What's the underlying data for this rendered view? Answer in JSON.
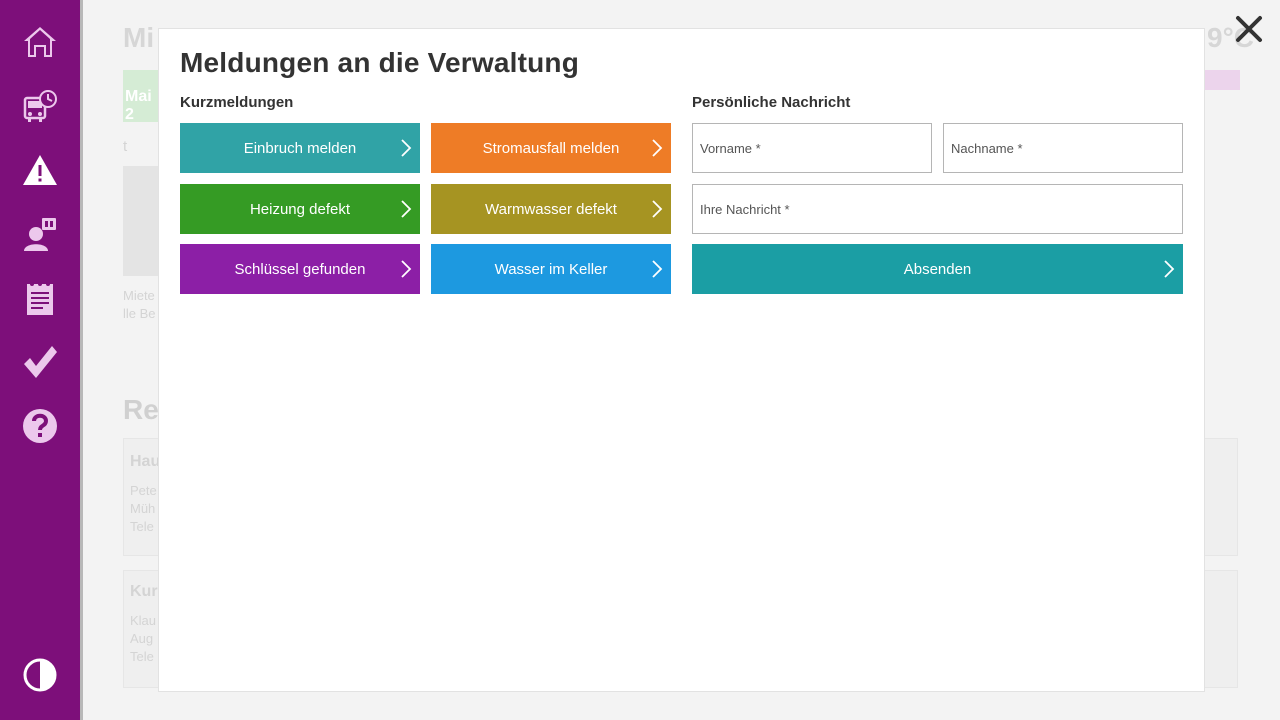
{
  "sidebar": {
    "items": [
      {
        "icon": "home-icon"
      },
      {
        "icon": "transport-schedule-icon"
      },
      {
        "icon": "warning-icon"
      },
      {
        "icon": "contact-person-icon"
      },
      {
        "icon": "notepad-icon"
      },
      {
        "icon": "checkmark-icon"
      },
      {
        "icon": "help-icon"
      }
    ],
    "bottom_icon": "contrast-icon"
  },
  "background": {
    "title": "Mi",
    "temperature": "9°C",
    "date": "Mai 2",
    "label_t": "t",
    "text1": "Miete",
    "text2": "lle Be",
    "heading2": "Re",
    "card1_title": "Hau",
    "card1_lines": [
      "Pete",
      "Müh",
      "Tele"
    ],
    "card2_title": "Kur",
    "card2_lines": [
      "Klau",
      "Aug",
      "Tele"
    ]
  },
  "modal": {
    "title": "Meldungen an die Verwaltung",
    "quick_label": "Kurzmeldungen",
    "personal_label": "Persönliche Nachricht",
    "quick_buttons": [
      {
        "label": "Einbruch melden",
        "color": "#30a3a6"
      },
      {
        "label": "Stromausfall melden",
        "color": "#ee7c26"
      },
      {
        "label": "Heizung defekt",
        "color": "#359b24"
      },
      {
        "label": "Warmwasser defekt",
        "color": "#a69422"
      },
      {
        "label": "Schlüssel gefunden",
        "color": "#8c1fa6"
      },
      {
        "label": "Wasser im Keller",
        "color": "#1d99e0"
      }
    ],
    "form": {
      "firstname_placeholder": "Vorname *",
      "lastname_placeholder": "Nachname *",
      "message_placeholder": "Ihre Nachricht *",
      "submit_label": "Absenden"
    }
  },
  "colors": {
    "sidebar": "#7d0f7a",
    "submit": "#1b9ea4",
    "icon": "#ecc8ec"
  }
}
